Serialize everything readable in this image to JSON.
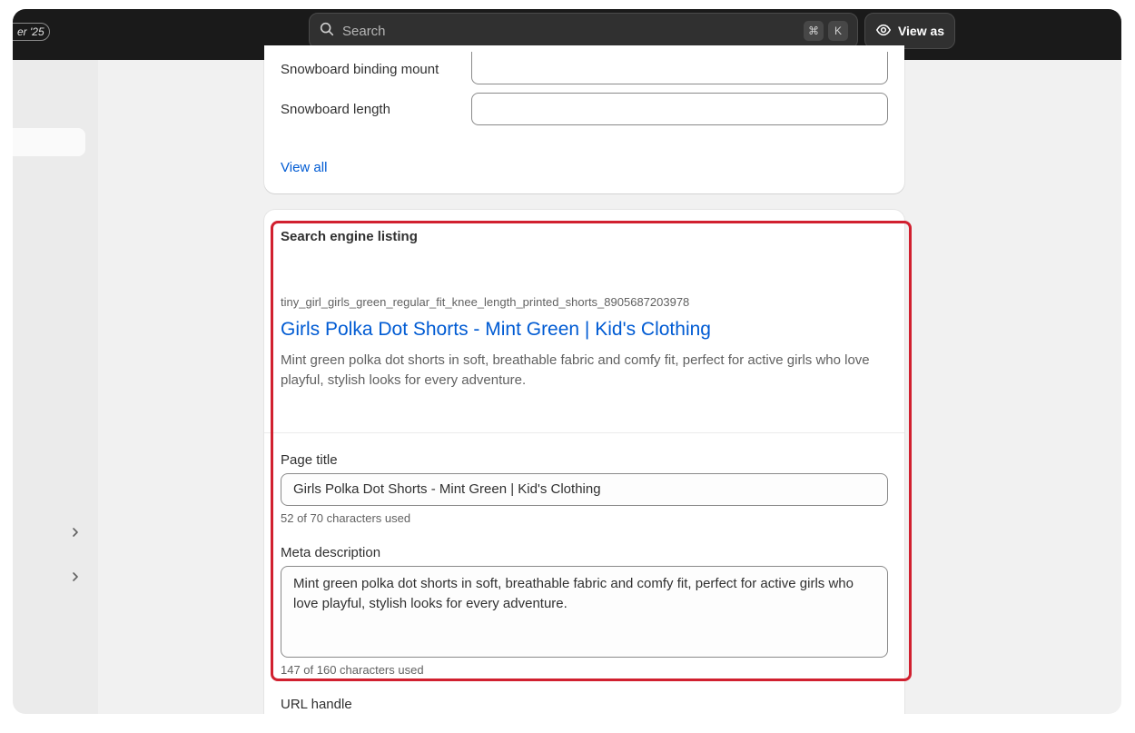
{
  "topbar": {
    "edition_badge": "er '25",
    "search_placeholder": "Search",
    "shortcut_key_1": "⌘",
    "shortcut_key_2": "K",
    "view_as_label": "View as"
  },
  "metafields": {
    "rows": [
      {
        "label": "Snowboard binding mount",
        "value": ""
      },
      {
        "label": "Snowboard length",
        "value": ""
      }
    ],
    "view_all_label": "View all"
  },
  "seo": {
    "section_title": "Search engine listing",
    "preview": {
      "url": "tiny_girl_girls_green_regular_fit_knee_length_printed_shorts_8905687203978",
      "title": "Girls Polka Dot Shorts - Mint Green | Kid's Clothing",
      "description": "Mint green polka dot shorts in soft, breathable fabric and comfy fit, perfect for active girls who love playful, stylish looks for every adventure."
    },
    "page_title": {
      "label": "Page title",
      "value": "Girls Polka Dot Shorts - Mint Green | Kid's Clothing",
      "help": "52 of 70 characters used"
    },
    "meta_description": {
      "label": "Meta description",
      "value": "Mint green polka dot shorts in soft, breathable fabric and comfy fit, perfect for active girls who love playful, stylish looks for every adventure.",
      "help": "147 of 160 characters used"
    },
    "url_handle": {
      "label": "URL handle"
    }
  },
  "colors": {
    "topbar": "#1a1a1a",
    "link": "#005bd3",
    "highlight": "#d1202f"
  }
}
